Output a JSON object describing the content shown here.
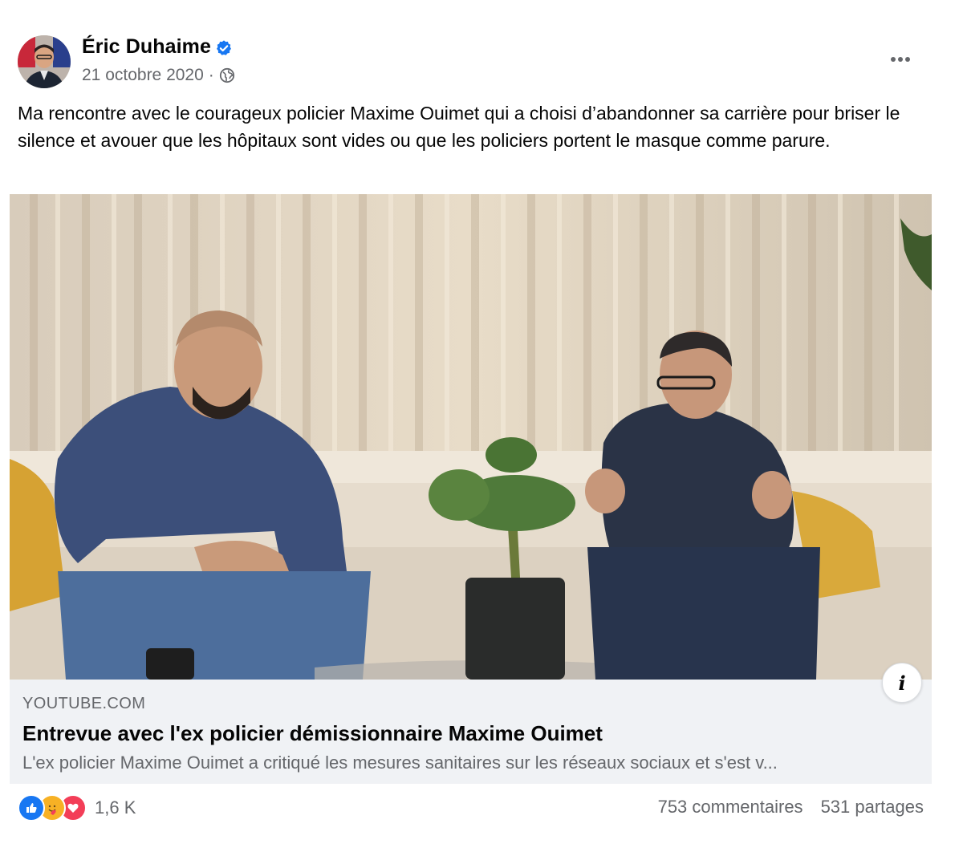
{
  "post": {
    "author": "Éric Duhaime",
    "verified": true,
    "date": "21 octobre 2020",
    "separator": "·",
    "privacy_icon": "globe-icon",
    "more_icon": "more-horizontal-icon",
    "text": "Ma rencontre avec le courageux policier Maxime Ouimet qui a choisi d’abandonner sa carrière pour briser le silence et avouer que les hôpitaux sont vides ou que les policiers portent le masque comme parure."
  },
  "link_preview": {
    "domain": "YOUTUBE.COM",
    "title": "Entrevue avec l'ex policier démissionnaire Maxime Ouimet",
    "description": "L'ex policier Maxime Ouimet a critiqué les mesures sanitaires sur les réseaux sociaux et s'est v...",
    "info_label": "i"
  },
  "footer": {
    "reaction_icons": [
      "like-icon",
      "care-icon",
      "love-icon"
    ],
    "reaction_count": "1,6 K",
    "comments": "753 commentaires",
    "shares": "531 partages"
  },
  "colors": {
    "verified": "#1877f2",
    "like": "#1877f2",
    "care": "#f7b125",
    "love": "#f33e58",
    "secondary_text": "#65676b"
  }
}
